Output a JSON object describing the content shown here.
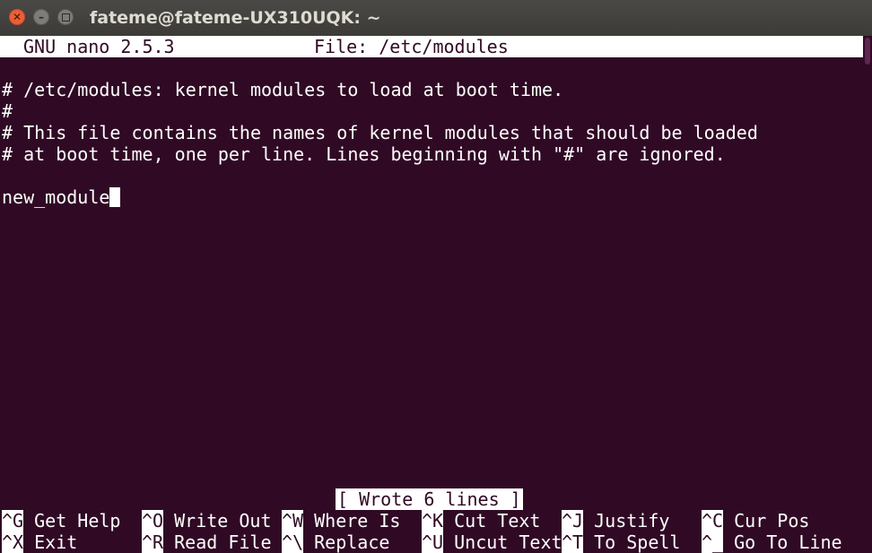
{
  "window": {
    "title": "fateme@fateme-UX310UQK: ~"
  },
  "nano": {
    "version": "GNU nano 2.5.3",
    "file": "File: /etc/modules",
    "lines": [
      "# /etc/modules: kernel modules to load at boot time.",
      "#",
      "# This file contains the names of kernel modules that should be loaded",
      "# at boot time, one per line. Lines beginning with \"#\" are ignored.",
      "",
      "new_module"
    ],
    "status": "[ Wrote 6 lines ]",
    "shortcuts_row1": [
      {
        "key": "^G",
        "label": " Get Help"
      },
      {
        "key": "^O",
        "label": " Write Out"
      },
      {
        "key": "^W",
        "label": " Where Is"
      },
      {
        "key": "^K",
        "label": " Cut Text"
      },
      {
        "key": "^J",
        "label": " Justify"
      },
      {
        "key": "^C",
        "label": " Cur Pos"
      }
    ],
    "shortcuts_row2": [
      {
        "key": "^X",
        "label": " Exit"
      },
      {
        "key": "^R",
        "label": " Read File"
      },
      {
        "key": "^\\",
        "label": " Replace"
      },
      {
        "key": "^U",
        "label": " Uncut Text"
      },
      {
        "key": "^T",
        "label": " To Spell"
      },
      {
        "key": "^_",
        "label": " Go To Line"
      }
    ]
  },
  "colors": {
    "terminal_bg": "#300a24",
    "titlebar_bg": "#3c3b37",
    "close_button": "#ec5f36"
  }
}
